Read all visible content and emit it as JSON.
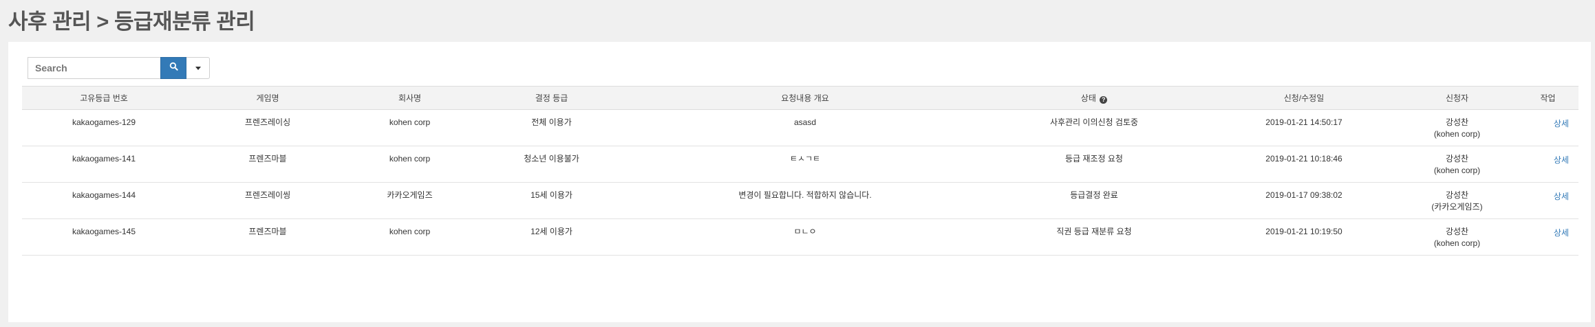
{
  "page": {
    "title": "사후 관리 > 등급재분류 관리"
  },
  "search": {
    "placeholder": "Search"
  },
  "table": {
    "columns": [
      "고유등급 번호",
      "게임명",
      "회사명",
      "결정 등급",
      "요청내용 개요",
      "상태",
      "신청/수정일",
      "신청자",
      "작업"
    ],
    "rows": [
      {
        "id": "kakaogames-129",
        "game": "프렌즈레이싱",
        "company": "kohen corp",
        "rating": "전체 이용가",
        "summary": "asasd",
        "status": "사후관리 이의신청 검토중",
        "date": "2019-01-21 14:50:17",
        "applicant": "강성찬",
        "applicant_company": "(kohen corp)",
        "action": "상세"
      },
      {
        "id": "kakaogames-141",
        "game": "프렌즈마블",
        "company": "kohen corp",
        "rating": "청소년 이용불가",
        "summary": "ㅌㅅㄱㅌ",
        "status": "등급 재조정 요청",
        "date": "2019-01-21 10:18:46",
        "applicant": "강성찬",
        "applicant_company": "(kohen corp)",
        "action": "상세"
      },
      {
        "id": "kakaogames-144",
        "game": "프렌즈레이씽",
        "company": "카카오게임즈",
        "rating": "15세 이용가",
        "summary": "변경이 필요합니다. 적합하지 않습니다.",
        "status": "등급결정 완료",
        "date": "2019-01-17 09:38:02",
        "applicant": "강성찬",
        "applicant_company": "(카카오게임즈)",
        "action": "상세"
      },
      {
        "id": "kakaogames-145",
        "game": "프렌즈마블",
        "company": "kohen corp",
        "rating": "12세 이용가",
        "summary": "ㅁㄴㅇ",
        "status": "직권 등급 재분류 요청",
        "date": "2019-01-21 10:19:50",
        "applicant": "강성찬",
        "applicant_company": "(kohen corp)",
        "action": "상세"
      }
    ]
  },
  "icons": {
    "search": "search-icon",
    "dropdown": "caret-down-icon",
    "help": "question-circle-icon"
  },
  "colors": {
    "accent": "#337ab7",
    "header_bg": "#f3f3f3",
    "page_bg": "#f0f0f0"
  }
}
